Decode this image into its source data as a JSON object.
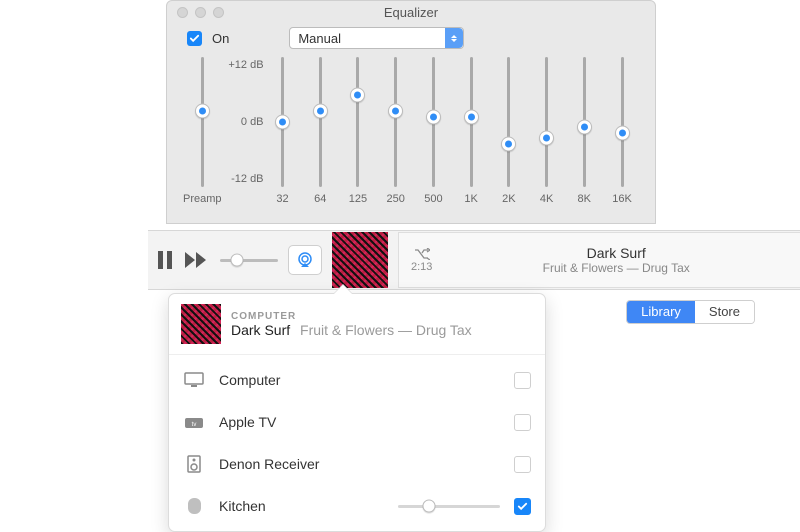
{
  "equalizer": {
    "window_title": "Equalizer",
    "on_label": "On",
    "on_checked": true,
    "preset": "Manual",
    "scale": {
      "max": "+12 dB",
      "mid": "0 dB",
      "min": "-12 dB"
    },
    "preamp": {
      "label": "Preamp",
      "value_db": 2
    },
    "bands": [
      {
        "freq": "32",
        "value_db": 0
      },
      {
        "freq": "64",
        "value_db": 2
      },
      {
        "freq": "125",
        "value_db": 5
      },
      {
        "freq": "250",
        "value_db": 2
      },
      {
        "freq": "500",
        "value_db": 1
      },
      {
        "freq": "1K",
        "value_db": 1
      },
      {
        "freq": "2K",
        "value_db": -4
      },
      {
        "freq": "4K",
        "value_db": -3
      },
      {
        "freq": "8K",
        "value_db": -1
      },
      {
        "freq": "16K",
        "value_db": -2
      }
    ]
  },
  "player": {
    "volume_pct": 30,
    "elapsed": "2:13",
    "title": "Dark Surf",
    "subtitle": "Fruit & Flowers — Drug Tax",
    "shuffle_on": true
  },
  "tabs": {
    "library_label": "Library",
    "store_label": "Store",
    "active": "library"
  },
  "airplay": {
    "heading_label": "COMPUTER",
    "song": "Dark Surf",
    "meta": "Fruit & Flowers — Drug Tax",
    "devices": [
      {
        "icon": "display",
        "name": "Computer",
        "checked": false,
        "volume_pct": null
      },
      {
        "icon": "appletv",
        "name": "Apple TV",
        "checked": false,
        "volume_pct": null
      },
      {
        "icon": "speaker",
        "name": "Denon Receiver",
        "checked": false,
        "volume_pct": null
      },
      {
        "icon": "homepod",
        "name": "Kitchen",
        "checked": true,
        "volume_pct": 30
      }
    ]
  }
}
